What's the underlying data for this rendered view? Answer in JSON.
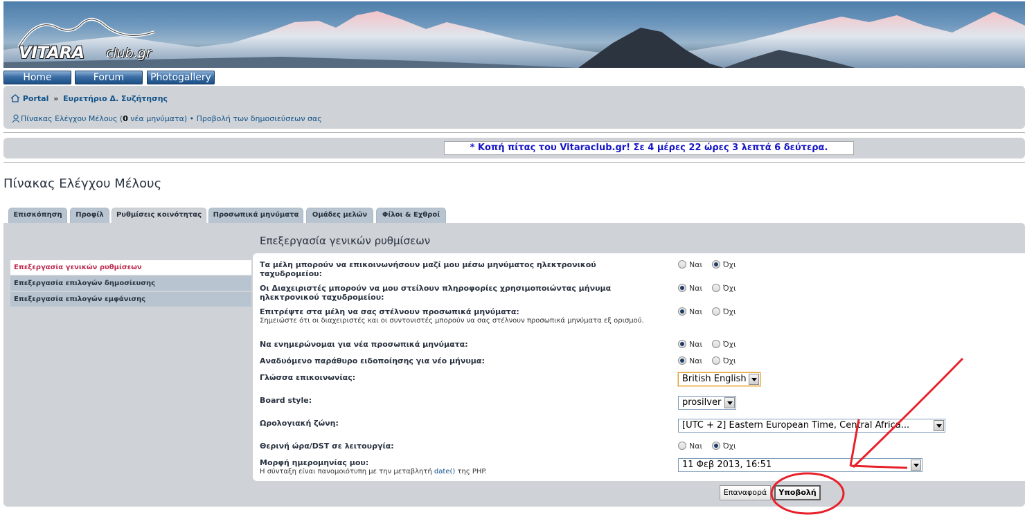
{
  "site": {
    "logo_main": "VITARA",
    "logo_sub": "club.gr"
  },
  "topnav": [
    "Home",
    "Forum",
    "Photogallery"
  ],
  "breadcrumb": {
    "items": [
      "Portal",
      "Ευρετήριο Δ. Συζήτησης"
    ],
    "separator": "»"
  },
  "ucp_links": {
    "panel_label": "Πίνακας Ελέγχου Μέλους (",
    "new_count": "0",
    "new_label": " νέα μηνύματα)",
    "bullet": " • ",
    "view_posts": "Προβολή των δημοσιεύσεων σας"
  },
  "countdown": "* Κοπή πίτας του Vitaraclub.gr! Σε 4 μέρες 22 ώρες 3 λεπτά 6 δεύτερα.",
  "page_title": "Πίνακας Ελέγχου Μέλους",
  "tabs": [
    "Επισκόπηση",
    "Προφίλ",
    "Ρυθμίσεις κοινότητας",
    "Προσωπικά μηνύματα",
    "Ομάδες μελών",
    "Φίλοι & Εχθροί"
  ],
  "active_tab": "Ρυθμίσεις κοινότητας",
  "side_menu": [
    "Επεξεργασία γενικών ρυθμίσεων",
    "Επεξεργασία επιλογών δημοσίευσης",
    "Επεξεργασία επιλογών εμφάνισης"
  ],
  "panel_title": "Επεξεργασία γενικών ρυθμίσεων",
  "form": {
    "yes": "Ναι",
    "no": "Όχι",
    "rows": [
      {
        "label": "Τα μέλη μπορούν να επικοινωνήσουν μαζί μου μέσω μηνύματος ηλεκτρονικού ταχυδρομείου:",
        "selected": "no"
      },
      {
        "label": "Οι Διαχειριστές μπορούν να μου στείλουν πληροφορίες χρησιμοποιώντας μήνυμα ηλεκτρονικού ταχυδρομείου:",
        "selected": "yes"
      },
      {
        "label": "Επιτρέψτε στα μέλη να σας στέλνουν προσωπικά μηνύματα:",
        "explain": "Σημειώστε ότι οι διαχειριστές και οι συντονιστές μπορούν να σας στέλνουν προσωπικά μηνύματα εξ ορισμού.",
        "selected": "yes"
      },
      {
        "label": "Να ενημερώνομαι για νέα προσωπικά μηνύματα:",
        "selected": "yes"
      },
      {
        "label": "Αναδυόμενο παράθυρο ειδοποίησης για νέο μήνυμα:",
        "selected": "yes"
      },
      {
        "label": "Θερινή ώρα/DST σε λειτουργία:",
        "selected": "no"
      }
    ],
    "language_label": "Γλώσσα επικοινωνίας:",
    "language_value": "British English",
    "style_label": "Board style:",
    "style_value": "prosilver",
    "timezone_label": "Ωρολογιακή ζώνη:",
    "timezone_value": "[UTC + 2] Eastern European Time, Central Africa...",
    "dateformat_label": "Μορφή ημερομηνίας μου:",
    "dateformat_explain_pre": "Η σύνταξη είναι πανομοιότυπη με την μεταβλητή ",
    "dateformat_explain_link": "date()",
    "dateformat_explain_post": " της PHP.",
    "dateformat_value": "11 Φεβ 2013, 16:51"
  },
  "buttons": {
    "reset": "Επαναφορά",
    "submit": "Υποβολή"
  },
  "annotation_color": "#e8202a"
}
